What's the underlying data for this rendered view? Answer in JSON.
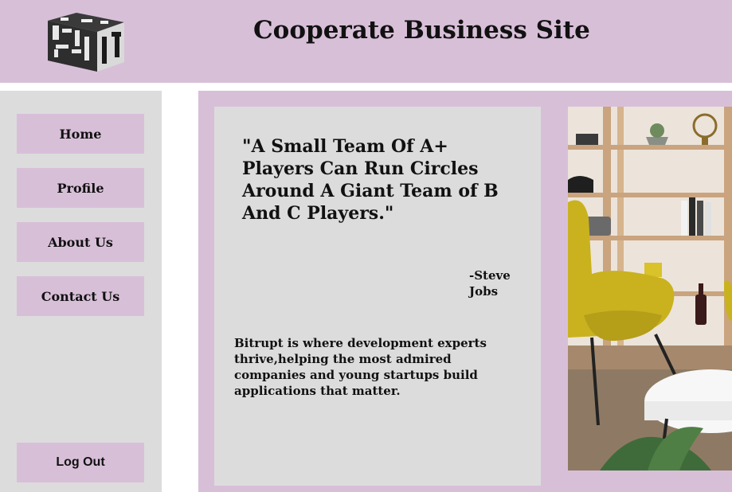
{
  "header": {
    "title": "Cooperate Business Site",
    "logo_icon": "cube-logo-icon"
  },
  "sidebar": {
    "items": [
      {
        "label": "Home"
      },
      {
        "label": "Profile"
      },
      {
        "label": "About Us"
      },
      {
        "label": "Contact Us"
      }
    ],
    "logout_label": "Log Out"
  },
  "main": {
    "quote": "\"A Small Team Of A+ Players Can Run Circles Around A Giant Team of B And C Players.\"",
    "author": "-Steve Jobs",
    "about": "Bitrupt is where development experts thrive,helping the most admired companies and young startups build applications that matter.",
    "photo_icon": "office-interior-photo"
  },
  "colors": {
    "accent": "#d8bfd8",
    "panel": "#dcdcdc",
    "text": "#111111"
  }
}
